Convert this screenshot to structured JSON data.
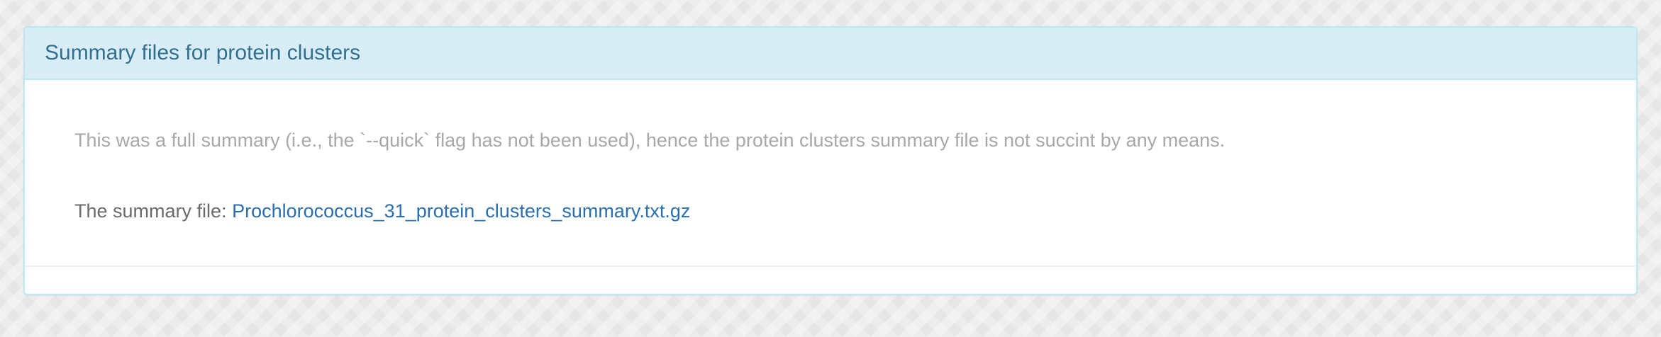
{
  "panel": {
    "title": "Summary files for protein clusters",
    "description": "This was a full summary (i.e., the `--quick` flag has not been used), hence the protein clusters summary file is not succint by any means.",
    "summary_label": "The summary file:",
    "summary_link_text": "Prochlorococcus_31_protein_clusters_summary.txt.gz"
  },
  "colors": {
    "heading_bg": "#d9edf7",
    "heading_text": "#31708f",
    "panel_border": "#bce8f1",
    "link": "#2a6fb0"
  }
}
